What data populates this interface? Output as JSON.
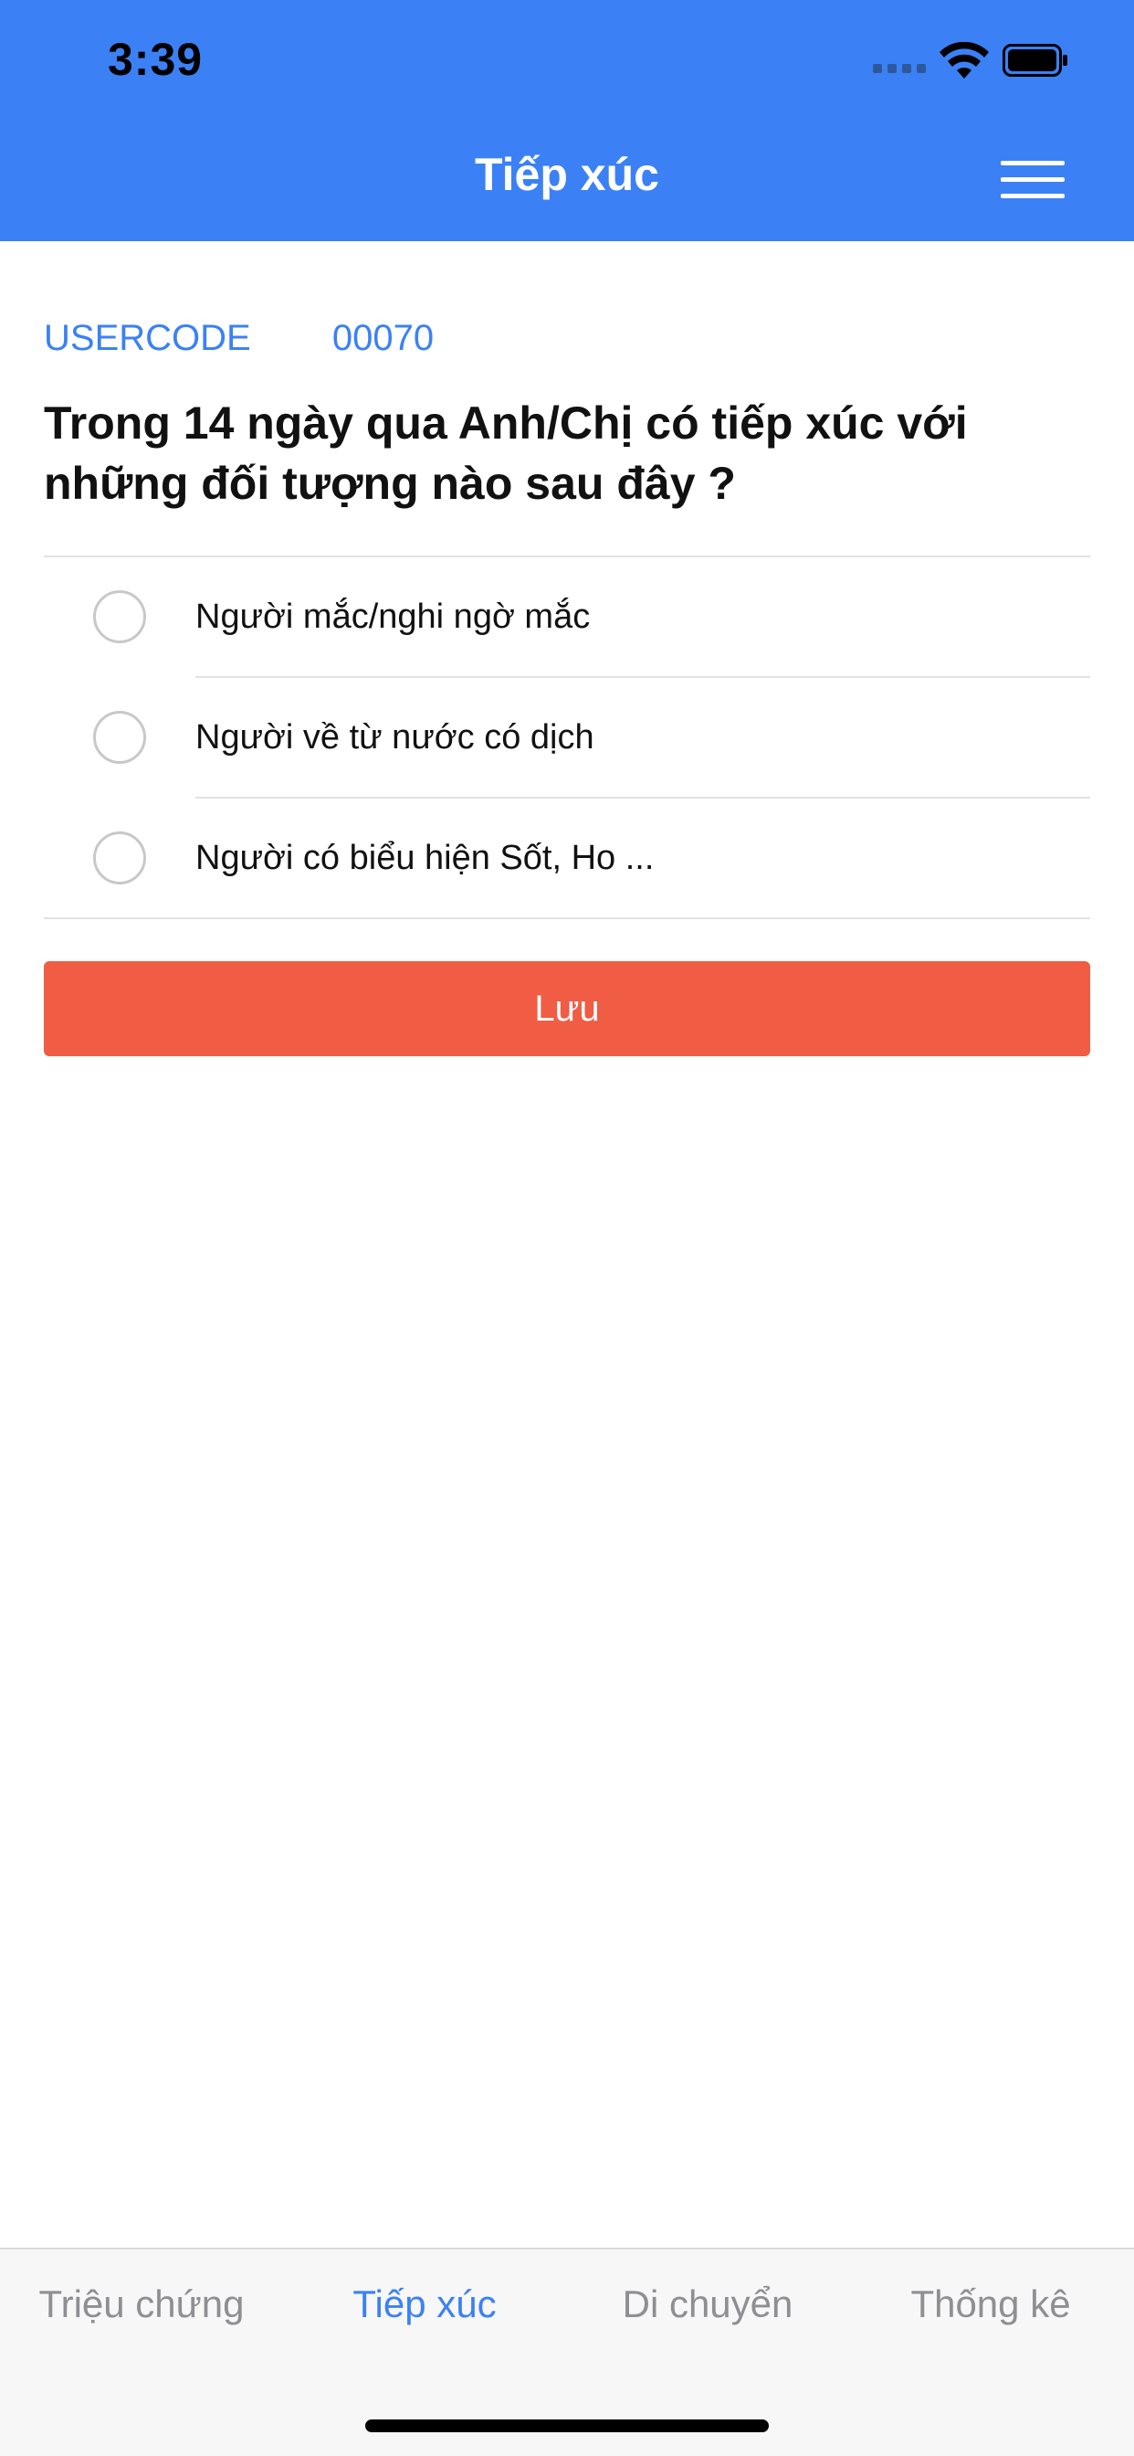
{
  "status_bar": {
    "time": "3:39"
  },
  "header": {
    "title": "Tiếp xúc",
    "menu_icon": "hamburger-menu-icon"
  },
  "colors": {
    "primary": "#3b81f5",
    "save_button": "#f05c44",
    "tab_inactive": "#8e8e93"
  },
  "user": {
    "code_label": "USERCODE",
    "code_value": "00070"
  },
  "question": "Trong 14 ngày qua Anh/Chị có tiếp xúc với những đối tượng nào sau đây ?",
  "options": [
    {
      "label": "Người mắc/nghi ngờ mắc",
      "selected": false
    },
    {
      "label": "Người về từ nước có dịch",
      "selected": false
    },
    {
      "label": "Người có biểu hiện Sốt, Ho ...",
      "selected": false
    }
  ],
  "save_label": "Lưu",
  "tabs": [
    {
      "label": "Triệu chứng",
      "active": false
    },
    {
      "label": "Tiếp xúc",
      "active": true
    },
    {
      "label": "Di chuyển",
      "active": false
    },
    {
      "label": "Thống kê",
      "active": false
    }
  ]
}
